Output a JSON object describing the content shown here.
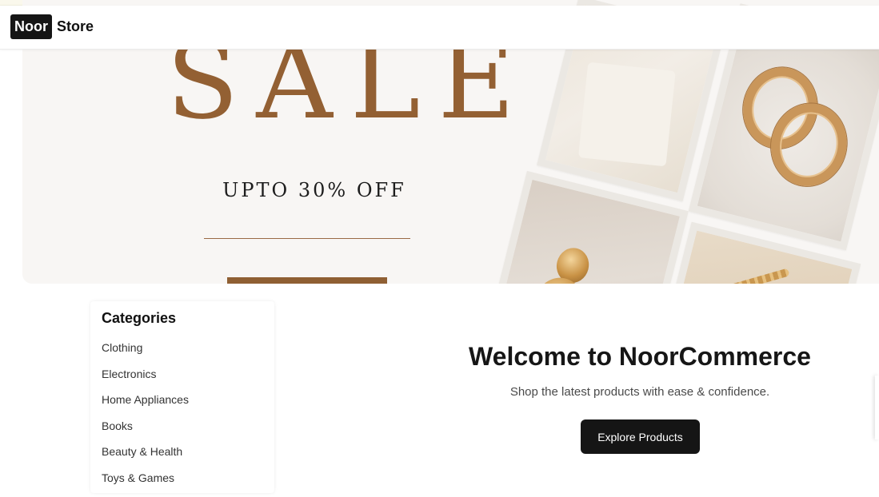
{
  "header": {
    "logo_badge": "Noor",
    "logo_text": "Store"
  },
  "banner": {
    "headline": "SALE",
    "offer": "UPTO 30% OFF",
    "accent_color": "#936033"
  },
  "categories": {
    "title": "Categories",
    "items": [
      "Clothing",
      "Electronics",
      "Home Appliances",
      "Books",
      "Beauty & Health",
      "Toys & Games"
    ]
  },
  "hero": {
    "title": "Welcome to NoorCommerce",
    "subtitle": "Shop the latest products with ease & confidence.",
    "cta_label": "Explore Products"
  }
}
